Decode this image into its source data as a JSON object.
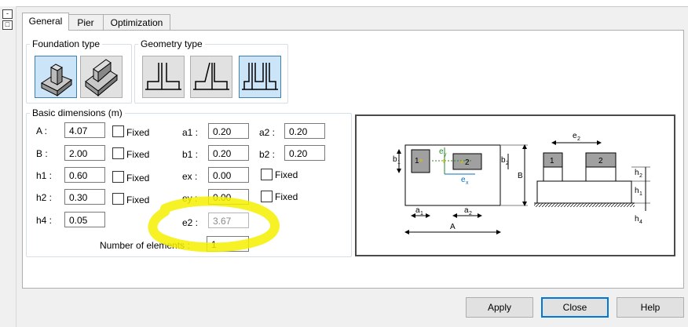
{
  "sidebar": {
    "btn1": "-",
    "btn2": "□"
  },
  "tabs": [
    "General",
    "Pier",
    "Optimization"
  ],
  "foundation_type": {
    "title": "Foundation type",
    "options": [
      "isolated-footing-icon",
      "continuous-footing-icon"
    ],
    "selected": 0
  },
  "geometry_type": {
    "title": "Geometry type",
    "options": [
      "single-pier-icon",
      "offset-pier-icon",
      "multi-pier-icon"
    ],
    "selected": 2
  },
  "basic_dimensions": {
    "title": "Basic dimensions (m)",
    "A": {
      "label": "A :",
      "value": "4.07"
    },
    "B": {
      "label": "B :",
      "value": "2.00"
    },
    "h1": {
      "label": "h1 :",
      "value": "0.60"
    },
    "h2": {
      "label": "h2 :",
      "value": "0.30"
    },
    "h4": {
      "label": "h4 :",
      "value": "0.05"
    },
    "a1": {
      "label": "a1 :",
      "value": "0.20"
    },
    "b1": {
      "label": "b1 :",
      "value": "0.20"
    },
    "ex": {
      "label": "ex :",
      "value": "0.00"
    },
    "ey": {
      "label": "ey :",
      "value": "0.00"
    },
    "e2": {
      "label": "e2 :",
      "value": "3.67"
    },
    "a2": {
      "label": "a2 :",
      "value": "0.20"
    },
    "b2": {
      "label": "b2 :",
      "value": "0.20"
    },
    "fixed_label": "Fixed",
    "num_elements": {
      "label": "Number of elements :",
      "value": "1"
    }
  },
  "diagram": {
    "labels": {
      "e2": "e",
      "e2_sub": "2",
      "ey": "e",
      "ey_sub": "y",
      "ex": "e",
      "ex_sub": "x",
      "b1": "b",
      "b1_sub": "1",
      "b2": "b",
      "b2_sub": "2",
      "B": "B",
      "a1": "a",
      "a1_sub": "1",
      "a2": "a",
      "a2_sub": "2",
      "A": "A",
      "h2": "h",
      "h2_sub": "2",
      "h1": "h",
      "h1_sub": "1",
      "h4": "h",
      "h4_sub": "4",
      "p1": "1",
      "p2": "2"
    }
  },
  "buttons": {
    "apply": "Apply",
    "close": "Close",
    "help": "Help"
  },
  "highlight_color": "#f5f000"
}
